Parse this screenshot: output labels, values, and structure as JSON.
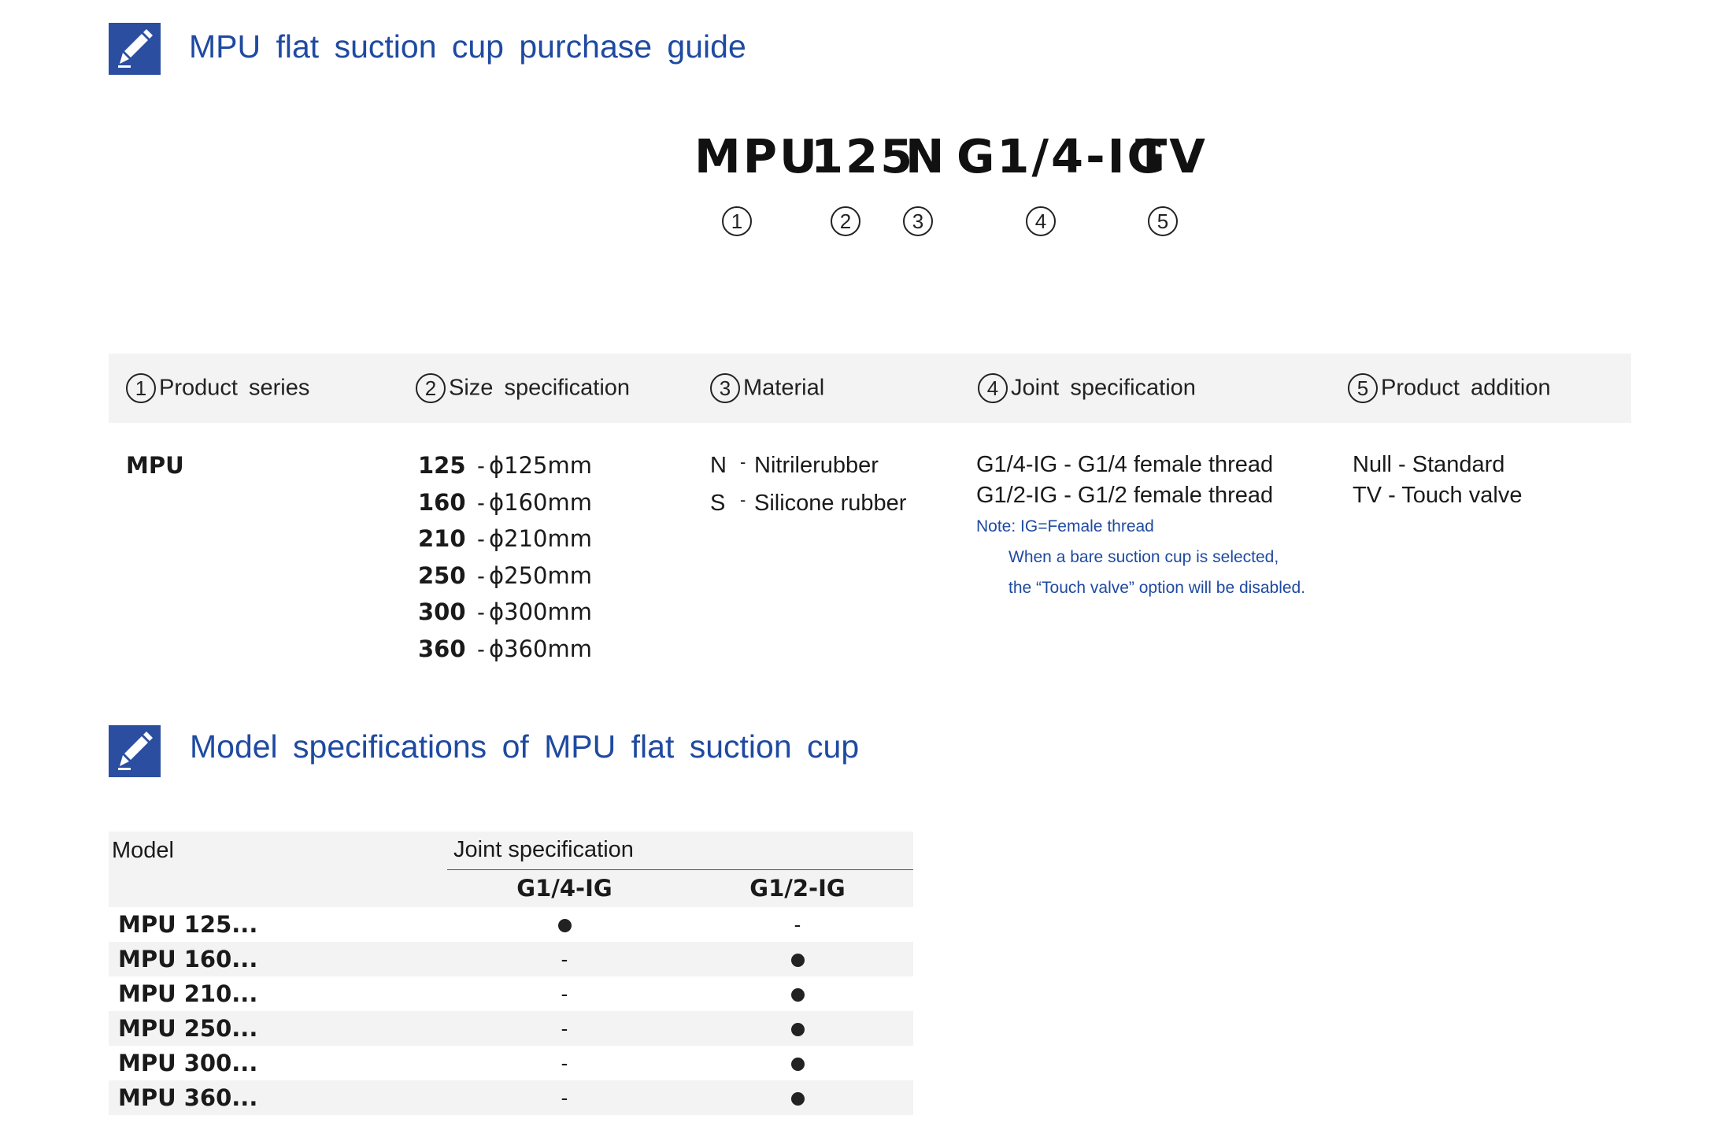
{
  "section1": {
    "icon": "pencil-icon",
    "title": "MPU flat suction  cup purchase  guide"
  },
  "code": {
    "parts": [
      "MPU",
      "125",
      "N",
      "G1/4-IG",
      "TV"
    ],
    "markers": [
      "1",
      "2",
      "3",
      "4",
      "5"
    ]
  },
  "columns": [
    {
      "marker": "1",
      "label": "Product  series"
    },
    {
      "marker": "2",
      "label": "Size specification"
    },
    {
      "marker": "3",
      "label": "Material"
    },
    {
      "marker": "4",
      "label": "Joint  specification"
    },
    {
      "marker": "5",
      "label": "Product addition"
    }
  ],
  "series": "MPU",
  "sizes": [
    {
      "num": "125",
      "dash": "-",
      "dim": "ϕ125mm"
    },
    {
      "num": "160",
      "dash": "-",
      "dim": "ϕ160mm"
    },
    {
      "num": "210",
      "dash": "-",
      "dim": "ϕ210mm"
    },
    {
      "num": "250",
      "dash": "-",
      "dim": "ϕ250mm"
    },
    {
      "num": "300",
      "dash": "-",
      "dim": "ϕ300mm"
    },
    {
      "num": "360",
      "dash": "-",
      "dim": "ϕ360mm"
    }
  ],
  "materials": [
    {
      "code": "N",
      "dash": "-",
      "name": "Nitrilerubber"
    },
    {
      "code": "S",
      "dash": "-",
      "name": "Silicone rubber"
    }
  ],
  "joints": [
    "G1/4-IG - G1/4 female thread",
    "G1/2-IG - G1/2 female thread"
  ],
  "notes": [
    "Note: IG=Female thread",
    "When a bare suction cup is selected,",
    "the “Touch valve” option will be disabled."
  ],
  "additions": [
    "Null - Standard",
    "TV - Touch valve"
  ],
  "section2": {
    "icon": "pencil-icon",
    "title": "Model specifications  of MPU flat suction  cup"
  },
  "spec_table": {
    "model_header": "Model",
    "group_header": "Joint  specification",
    "col_headers": [
      "G1/4-IG",
      "G1/2-IG"
    ],
    "rows": [
      {
        "model": "MPU 125...",
        "g14": "●",
        "g12": "-"
      },
      {
        "model": "MPU 160...",
        "g14": "-",
        "g12": "●"
      },
      {
        "model": "MPU 210...",
        "g14": "-",
        "g12": "●"
      },
      {
        "model": "MPU 250...",
        "g14": "-",
        "g12": "●"
      },
      {
        "model": "MPU 300...",
        "g14": "-",
        "g12": "●"
      },
      {
        "model": "MPU 360...",
        "g14": "-",
        "g12": "●"
      }
    ]
  },
  "colors": {
    "accent": "#2b4ea0",
    "title_text": "#1f4aa1",
    "band": "#f3f3f3"
  }
}
